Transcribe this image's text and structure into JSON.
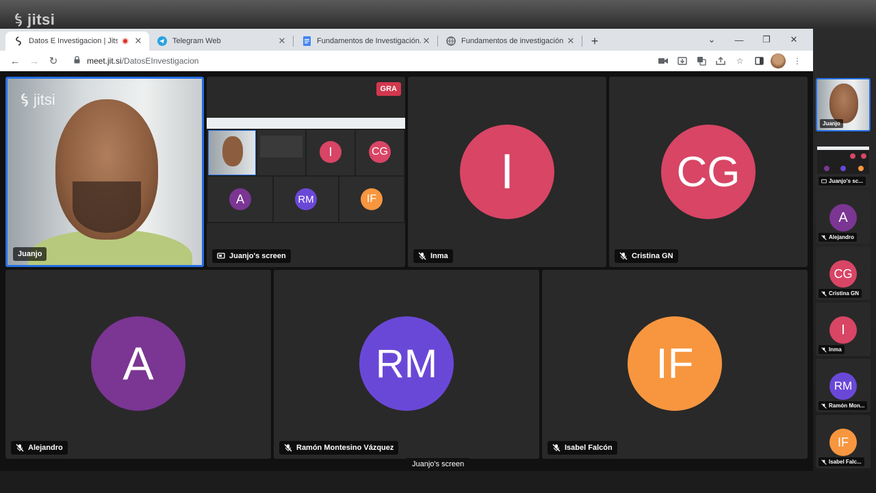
{
  "outer": {
    "logo_text": "jitsi"
  },
  "browser": {
    "tabs": [
      {
        "title": "Datos E Investigacion | Jitsi M",
        "active": true,
        "recording": true
      },
      {
        "title": "Telegram Web",
        "active": false
      },
      {
        "title": "Fundamentos de Investigación. T",
        "active": false
      },
      {
        "title": "Fundamentos de investigación e",
        "active": false
      }
    ],
    "address": {
      "host": "meet.jit.si",
      "path": "/DatosEInvestigacion"
    }
  },
  "meeting": {
    "logo_text": "jitsi",
    "recording_badge": "GRA",
    "tiles": [
      {
        "name": "Juanjo",
        "type": "video"
      },
      {
        "name": "Juanjo's screen",
        "type": "screen"
      },
      {
        "name": "Inma",
        "initials": "I",
        "color": "#d84565"
      },
      {
        "name": "Cristina GN",
        "initials": "CG",
        "color": "#d84565"
      },
      {
        "name": "Alejandro",
        "initials": "A",
        "color": "#7b3593"
      },
      {
        "name": "Ramón Montesino Vázquez",
        "initials": "RM",
        "color": "#6a48d7"
      },
      {
        "name": "Isabel Falcón",
        "initials": "IF",
        "color": "#f7963f"
      }
    ],
    "mini_share": {
      "avatars": [
        "I",
        "CG",
        "A",
        "RM",
        "IF"
      ]
    },
    "filmstrip": [
      {
        "label": "Juanjo"
      },
      {
        "label": "Juanjo's sc..."
      },
      {
        "label": "Alejandro",
        "initials": "A",
        "color": "#7b3593"
      },
      {
        "label": "Cristina GN",
        "initials": "CG",
        "color": "#d84565"
      },
      {
        "label": "Inma",
        "initials": "I",
        "color": "#d84565"
      },
      {
        "label": "Ramón Mon...",
        "initials": "RM",
        "color": "#6a48d7"
      },
      {
        "label": "Isabel Falc...",
        "initials": "IF",
        "color": "#f7963f"
      }
    ],
    "tooltip": "Juanjo's screen"
  }
}
